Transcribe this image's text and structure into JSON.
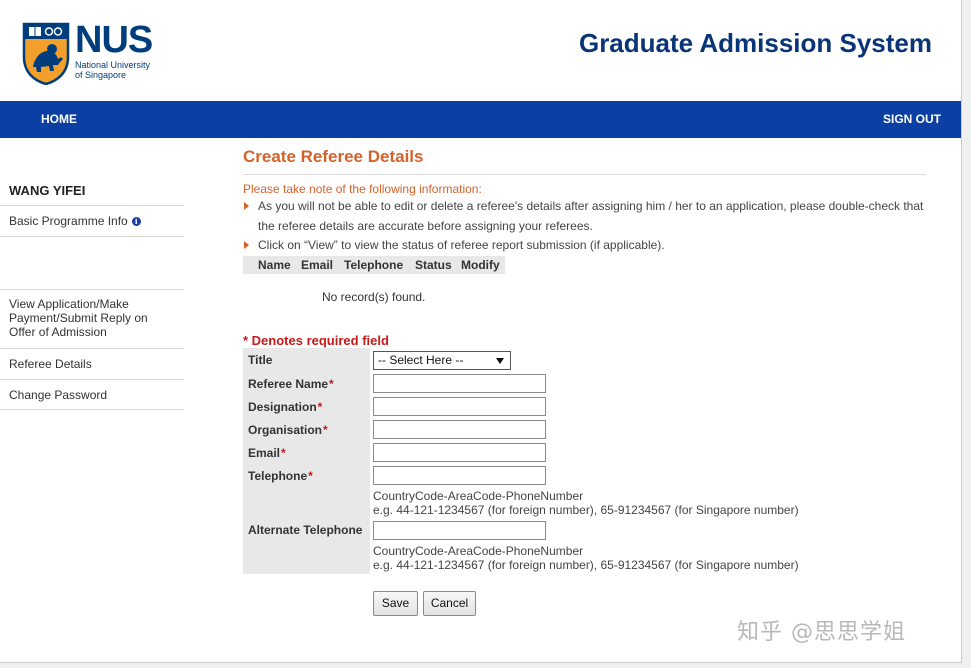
{
  "header": {
    "logo_abbrev": "NUS",
    "logo_line1": "National University",
    "logo_line2": "of Singapore",
    "system_title": "Graduate Admission System"
  },
  "nav": {
    "home": "HOME",
    "sign_out": "SIGN OUT"
  },
  "sidebar": {
    "user_name": "WANG YIFEI",
    "items": [
      {
        "label": "Basic Programme Info"
      },
      {
        "label": "View Application/Make Payment/Submit Reply on Offer of Admission"
      },
      {
        "label": "Referee Details"
      },
      {
        "label": "Change Password"
      }
    ]
  },
  "main": {
    "title": "Create Referee Details",
    "note_heading": "Please take note of the following information:",
    "notes": [
      "As you will not be able to edit or delete a referee's details after assigning him / her to an application, please double-check that the referee details are accurate before assigning your referees.",
      "Click on “View” to view the status of referee report submission (if applicable)."
    ],
    "table": {
      "columns": [
        "Name",
        "Email",
        "Telephone",
        "Status",
        "Modify"
      ],
      "empty_message": "No record(s) found."
    },
    "required_note": "* Denotes required field",
    "form": {
      "title_label": "Title",
      "title_select_value": "-- Select Here --",
      "referee_name_label": "Referee Name",
      "designation_label": "Designation",
      "organisation_label": "Organisation",
      "email_label": "Email",
      "telephone_label": "Telephone",
      "alternate_telephone_label": "Alternate Telephone",
      "required_mark": "*",
      "phone_hint_line1": "CountryCode-AreaCode-PhoneNumber",
      "phone_hint_line2": "e.g. 44-121-1234567 (for foreign number), 65-91234567 (for Singapore number)",
      "referee_name_value": "",
      "designation_value": "",
      "organisation_value": "",
      "email_value": "",
      "telephone_value": "",
      "alternate_telephone_value": ""
    },
    "buttons": {
      "save": "Save",
      "cancel": "Cancel"
    }
  },
  "watermark": "知乎 @思思学姐",
  "colors": {
    "brand_blue": "#0c3fa3",
    "title_blue": "#0a3478",
    "accent_orange": "#d4622a",
    "required_red": "#c41a1a"
  }
}
